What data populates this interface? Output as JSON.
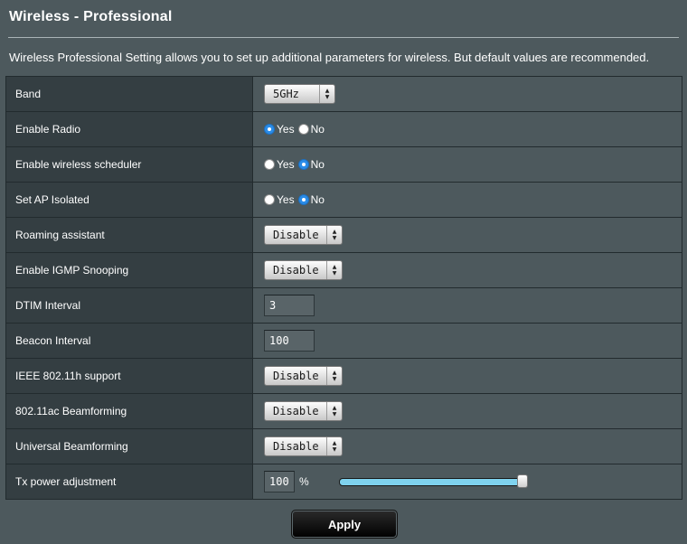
{
  "page": {
    "title": "Wireless - Professional",
    "description": "Wireless Professional Setting allows you to set up additional parameters for wireless. But default values are recommended."
  },
  "settings": {
    "band": {
      "label": "Band",
      "value": "5GHz"
    },
    "enable_radio": {
      "label": "Enable Radio",
      "yes": "Yes",
      "no": "No",
      "selected": "Yes"
    },
    "scheduler": {
      "label": "Enable wireless scheduler",
      "yes": "Yes",
      "no": "No",
      "selected": "No"
    },
    "ap_isolated": {
      "label": "Set AP Isolated",
      "yes": "Yes",
      "no": "No",
      "selected": "No"
    },
    "roaming": {
      "label": "Roaming assistant",
      "value": "Disable"
    },
    "igmp": {
      "label": "Enable IGMP Snooping",
      "value": "Disable"
    },
    "dtim": {
      "label": "DTIM Interval",
      "value": "3"
    },
    "beacon": {
      "label": "Beacon Interval",
      "value": "100"
    },
    "ieee80211h": {
      "label": "IEEE 802.11h support",
      "value": "Disable"
    },
    "ac_beamforming": {
      "label": "802.11ac Beamforming",
      "value": "Disable"
    },
    "universal_beamforming": {
      "label": "Universal Beamforming",
      "value": "Disable"
    },
    "tx_power": {
      "label": "Tx power adjustment",
      "value": "100",
      "unit": "%",
      "slider_fraction": 1.0
    }
  },
  "apply_label": "Apply",
  "colors": {
    "background": "#4d595d",
    "label_cell": "#343e42",
    "radio_selected": "#2a8ce8",
    "slider_fill": "#7fd3ef"
  },
  "icons": {
    "select_arrows": "up-down-chevron-icon"
  }
}
